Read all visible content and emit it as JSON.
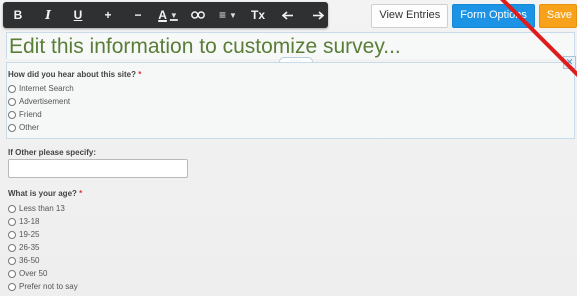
{
  "toolbar": {
    "bold": "B",
    "italic": "I",
    "underline": "U",
    "add": "+",
    "remove": "−",
    "font_color": "A",
    "align": "≡",
    "clear_format": "Tx",
    "icons": [
      "link-icon",
      "undo-icon",
      "redo-icon",
      "caret-down-icon"
    ]
  },
  "actions": {
    "view_entries": "View Entries",
    "form_options": "Form Options",
    "save": "Save"
  },
  "survey": {
    "title": "Edit this information to customize survey...",
    "q1": {
      "label": "How did you hear about this site?",
      "required_mark": "*",
      "options": [
        "Internet Search",
        "Advertisement",
        "Friend",
        "Other"
      ]
    },
    "q2": {
      "label": "If Other please specify:"
    },
    "q3": {
      "label": "What is your age?",
      "required_mark": "*",
      "options": [
        "Less than 13",
        "13-18",
        "19-25",
        "26-35",
        "36-50",
        "Over 50",
        "Prefer not to say"
      ]
    }
  },
  "colors": {
    "title": "#5a7e38",
    "blue_button": "#1c93e5",
    "orange_button": "#f7a21a",
    "red_line": "#e01b1b"
  }
}
